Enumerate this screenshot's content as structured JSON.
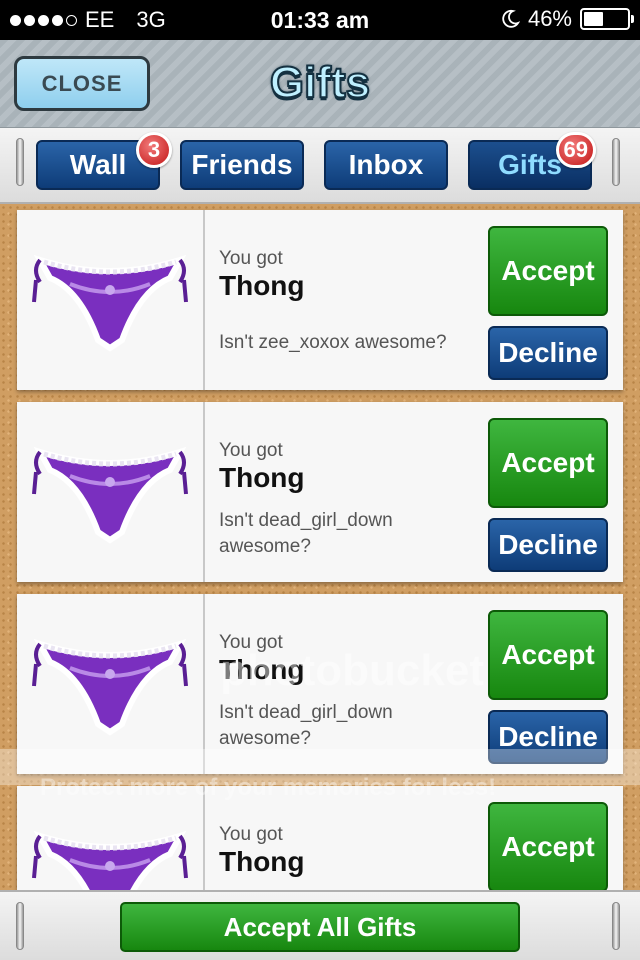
{
  "status_bar": {
    "carrier": "EE",
    "network": "3G",
    "time": "01:33 am",
    "battery": "46%",
    "battery_level": 0.46,
    "signal_bars_filled": 4,
    "signal_bars_total": 5
  },
  "header": {
    "close_label": "CLOSE",
    "title": "Gifts"
  },
  "tabs": [
    {
      "label": "Wall",
      "badge": "3"
    },
    {
      "label": "Friends",
      "badge": ""
    },
    {
      "label": "Inbox",
      "badge": ""
    },
    {
      "label": "Gifts",
      "badge": "69",
      "active": true
    }
  ],
  "gifts": [
    {
      "prefix": "You got",
      "name": "Thong",
      "message": "Isn't zee_xoxox awesome?",
      "accept": "Accept",
      "decline": "Decline"
    },
    {
      "prefix": "You got",
      "name": "Thong",
      "message": "Isn't dead_girl_down awesome?",
      "accept": "Accept",
      "decline": "Decline"
    },
    {
      "prefix": "You got",
      "name": "Thong",
      "message": "Isn't dead_girl_down awesome?",
      "accept": "Accept",
      "decline": "Decline"
    },
    {
      "prefix": "You got",
      "name": "Thong",
      "message": "",
      "accept": "Accept",
      "decline": ""
    }
  ],
  "watermark": {
    "logo_text": "photobucket",
    "tagline": "Protect more of your memories for less!"
  },
  "footer": {
    "accept_all_label": "Accept All Gifts"
  },
  "colors": {
    "accept_green": "#1f9a16",
    "tab_blue": "#0e3c78",
    "badge_red": "#c21515",
    "cork": "#d09e62"
  }
}
